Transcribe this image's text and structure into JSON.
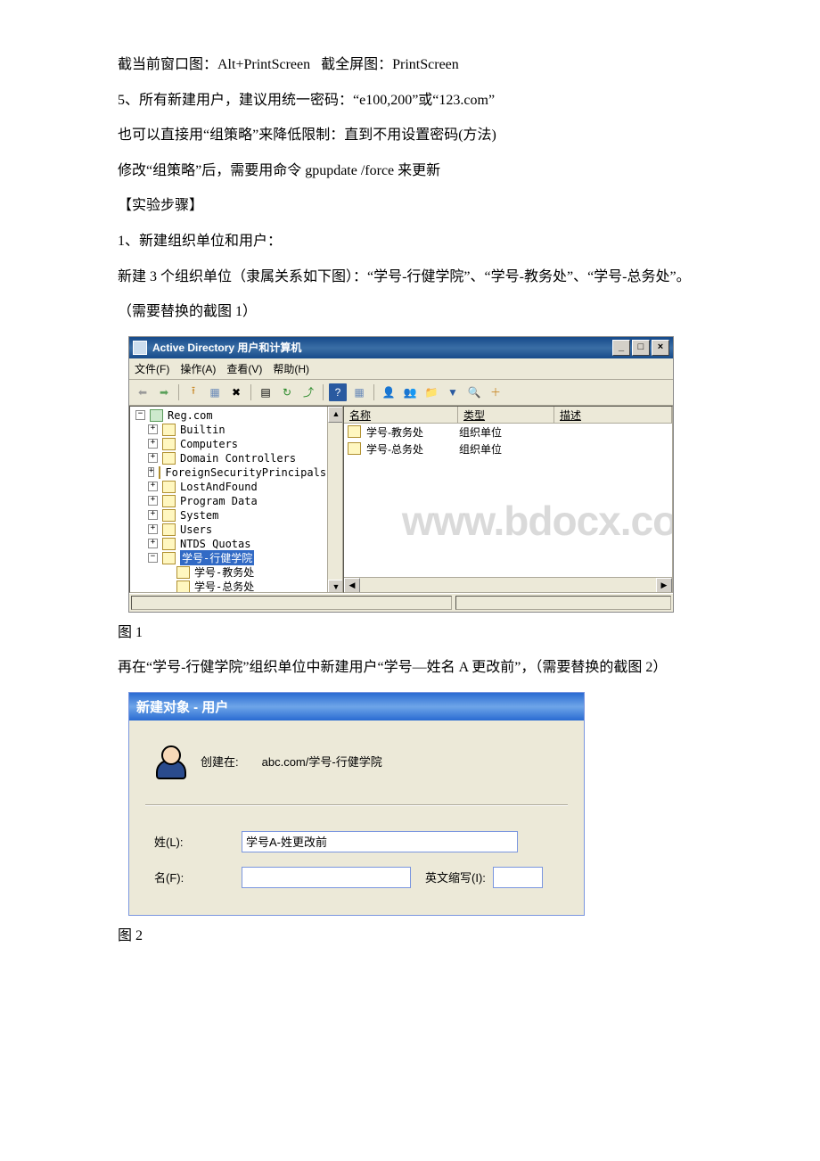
{
  "document": {
    "p1": "截当前窗口图：Alt+PrintScreen   截全屏图：PrintScreen",
    "p2": "5、所有新建用户，建议用统一密码：“e100,200”或“123.com”",
    "p3": "也可以直接用“组策略”来降低限制：直到不用设置密码(方法)",
    "p4": "修改“组策略”后，需要用命令 gpupdate /force 来更新",
    "p5": "【实验步骤】",
    "p6": "1、新建组织单位和用户：",
    "p7": "新建 3 个组织单位（隶属关系如下图）：“学号-行健学院”、“学号-教务处”、“学号-总务处”。",
    "p8": "（需要替换的截图 1）",
    "caption1": "图 1",
    "p9a": "再在“学号-行健学院”组织单位中新建用户“学号—姓名 A 更改前”，（需要替换的截图 2）",
    "caption2": "图 2"
  },
  "fig1": {
    "title": "Active Directory 用户和计算机",
    "winbtn_min": "_",
    "winbtn_max": "□",
    "winbtn_close": "×",
    "menu_file": "文件(F)",
    "menu_action": "操作(A)",
    "menu_view": "查看(V)",
    "menu_help": "帮助(H)",
    "tree": {
      "root": "Reg.com",
      "n1": "Builtin",
      "n2": "Computers",
      "n3": "Domain Controllers",
      "n4": "ForeignSecurityPrincipals",
      "n5": "LostAndFound",
      "n6": "Program Data",
      "n7": "System",
      "n8": "Users",
      "n9": "NTDS Quotas",
      "n10": "学号-行健学院",
      "n11": "学号-教务处",
      "n12": "学号-总务处"
    },
    "list": {
      "col_name": "名称",
      "col_type": "类型",
      "col_desc": "描述",
      "r1_name": "学号-教务处",
      "r1_type": "组织单位",
      "r2_name": "学号-总务处",
      "r2_type": "组织单位"
    },
    "watermark": "www.bdocx.com"
  },
  "fig2": {
    "title": "新建对象 - 用户",
    "createdin_label": "创建在:",
    "createdin_path": "abc.com/学号-行健学院",
    "row_lastname_label": "姓(L):",
    "row_lastname_value": "学号A-姓更改前",
    "row_firstname_label": "名(F):",
    "row_initials_label": "英文缩写(I):"
  }
}
